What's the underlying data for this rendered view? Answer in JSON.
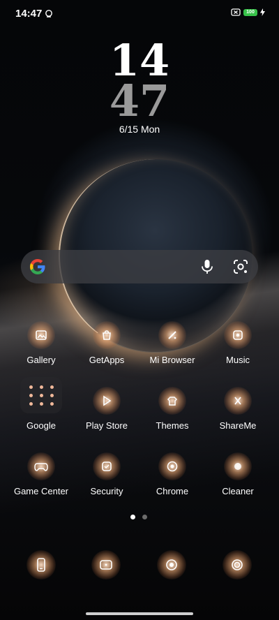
{
  "status_bar": {
    "time": "14:47",
    "battery": "100"
  },
  "clock": {
    "hour": "14",
    "minute": "47",
    "date": "6/15 Mon"
  },
  "apps": [
    {
      "label": "Gallery",
      "icon": "gallery-icon"
    },
    {
      "label": "GetApps",
      "icon": "getapps-icon"
    },
    {
      "label": "Mi Browser",
      "icon": "mi-browser-icon"
    },
    {
      "label": "Music",
      "icon": "music-icon"
    },
    {
      "label": "Google",
      "icon": "google-folder-icon"
    },
    {
      "label": "Play Store",
      "icon": "play-store-icon"
    },
    {
      "label": "Themes",
      "icon": "themes-icon"
    },
    {
      "label": "ShareMe",
      "icon": "shareme-icon"
    },
    {
      "label": "Game Center",
      "icon": "game-center-icon"
    },
    {
      "label": "Security",
      "icon": "security-icon"
    },
    {
      "label": "Chrome",
      "icon": "chrome-icon"
    },
    {
      "label": "Cleaner",
      "icon": "cleaner-icon"
    }
  ],
  "dock": [
    {
      "icon": "phone-icon"
    },
    {
      "icon": "messages-icon"
    },
    {
      "icon": "browser-icon"
    },
    {
      "icon": "camera-icon"
    }
  ],
  "page_indicator": {
    "current": 1,
    "total": 2
  },
  "colors": {
    "glow": "#f5b078",
    "battery_fill": "#38c24a",
    "search_bg": "#3c3e42"
  }
}
